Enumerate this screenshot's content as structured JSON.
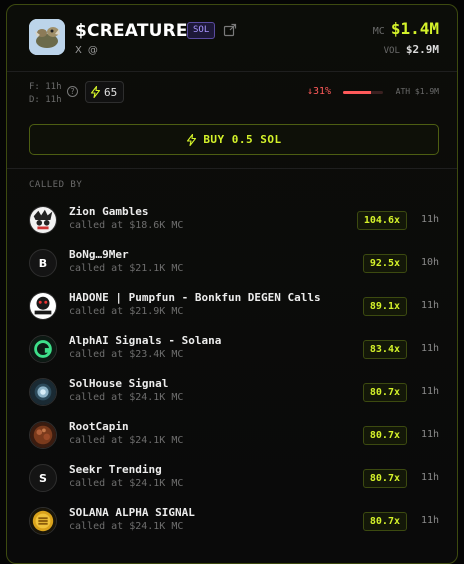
{
  "token": {
    "name": "$CREATURES",
    "chain": "SOL",
    "social": [
      "X",
      "@"
    ],
    "mc_label": "MC",
    "mc_value": "$1.4M",
    "vol_label": "VOL",
    "vol_value": "$2.9M"
  },
  "stats": {
    "first": "F: 11h",
    "dex": "D: 11h",
    "calls_count": "65",
    "drawdown_pct": "↓31%",
    "drawdown_fill": 0.69,
    "ath": "ATH $1.9M"
  },
  "buy_button": {
    "label": "BUY 0.5 SOL"
  },
  "called_by_label": "CALLED BY",
  "callers": [
    {
      "name": "Zion Gambles",
      "sub": "called at $18.6K MC",
      "mult": "104.6x",
      "time": "11h",
      "avatar": "zion",
      "initial": ""
    },
    {
      "name": "BoNg…9Mer",
      "sub": "called at $21.1K MC",
      "mult": "92.5x",
      "time": "10h",
      "avatar": "letter",
      "initial": "B"
    },
    {
      "name": "HADONE | Pumpfun - Bonkfun DEGEN Calls",
      "sub": "called at $21.9K MC",
      "mult": "89.1x",
      "time": "11h",
      "avatar": "hadone",
      "initial": ""
    },
    {
      "name": "AlphAI Signals - Solana",
      "sub": "called at $23.4K MC",
      "mult": "83.4x",
      "time": "11h",
      "avatar": "alphai",
      "initial": ""
    },
    {
      "name": "SolHouse Signal",
      "sub": "called at $24.1K MC",
      "mult": "80.7x",
      "time": "11h",
      "avatar": "solhouse",
      "initial": ""
    },
    {
      "name": "RootCapin",
      "sub": "called at $24.1K MC",
      "mult": "80.7x",
      "time": "11h",
      "avatar": "root",
      "initial": ""
    },
    {
      "name": "Seekr Trending",
      "sub": "called at $24.1K MC",
      "mult": "80.7x",
      "time": "11h",
      "avatar": "letter",
      "initial": "S"
    },
    {
      "name": "SOLANA ALPHA SIGNAL",
      "sub": "called at $24.1K MC",
      "mult": "80.7x",
      "time": "11h",
      "avatar": "coin",
      "initial": ""
    }
  ],
  "colors": {
    "accent": "#d4f22a",
    "negative": "#ff5a5a",
    "chain_badge": "#a896ff"
  }
}
